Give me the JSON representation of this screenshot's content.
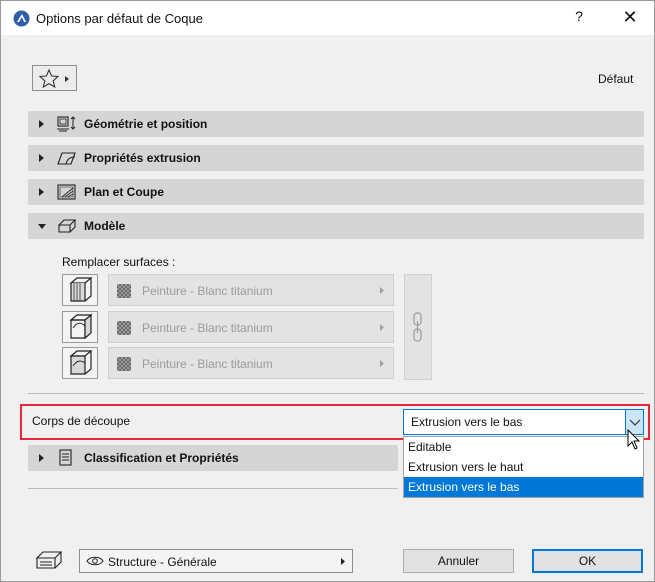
{
  "window": {
    "title": "Options par défaut de Coque",
    "help_label": "?",
    "close_label": "✕"
  },
  "header": {
    "favorites_icon": "star-icon",
    "default_label": "Défaut"
  },
  "panels": [
    {
      "label": "Géométrie et position",
      "icon": "geometry-icon",
      "expanded": false
    },
    {
      "label": "Propriétés extrusion",
      "icon": "extrusion-icon",
      "expanded": false
    },
    {
      "label": "Plan et Coupe",
      "icon": "floorplan-icon",
      "expanded": false
    },
    {
      "label": "Modèle",
      "icon": "model-icon",
      "expanded": true
    },
    {
      "label": "Classification et Propriétés",
      "icon": "classification-icon",
      "expanded": false
    }
  ],
  "model": {
    "override_label": "Remplacer surfaces :",
    "surfaces": [
      {
        "name": "Peinture - Blanc titanium",
        "icon": "surface-top-icon"
      },
      {
        "name": "Peinture - Blanc titanium",
        "icon": "surface-side-icon"
      },
      {
        "name": "Peinture - Blanc titanium",
        "icon": "surface-edge-icon"
      }
    ],
    "link_icon": "chain-link-icon"
  },
  "cutting": {
    "label": "Corps de découpe",
    "selected": "Extrusion vers le bas",
    "options": [
      "Editable",
      "Extrusion vers le haut",
      "Extrusion vers le bas"
    ],
    "highlight_color": "#e5283a"
  },
  "footer": {
    "structure_label": "Structure - Générale",
    "cancel_label": "Annuler",
    "ok_label": "OK"
  },
  "colors": {
    "accent": "#0078d7",
    "panel_bg": "#d5d5d5",
    "dialog_bg": "#f0f0f0"
  }
}
